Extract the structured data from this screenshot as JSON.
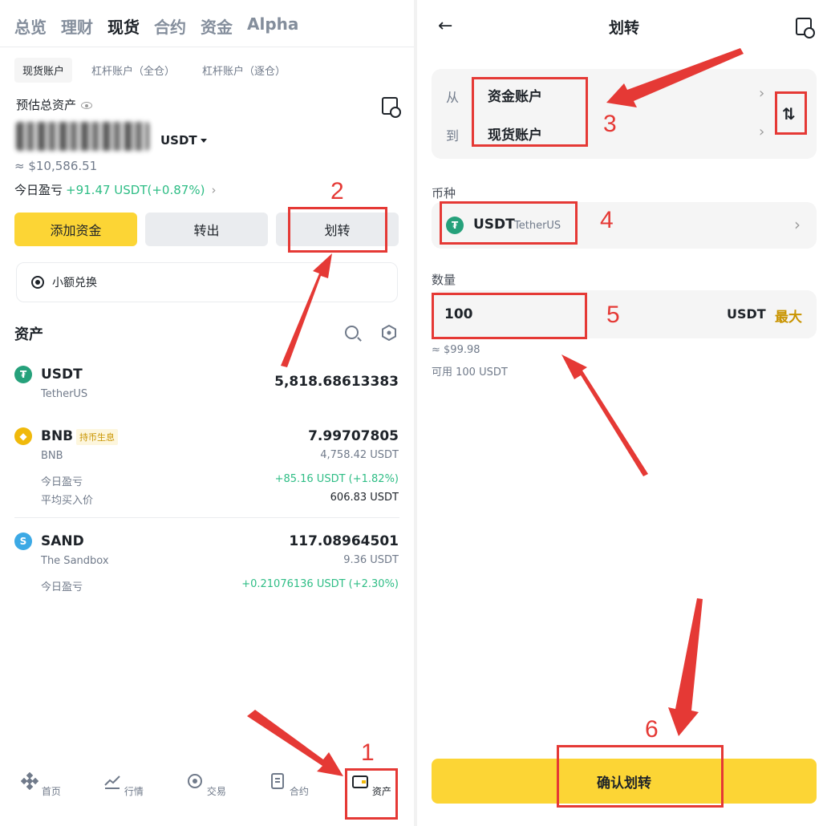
{
  "left": {
    "top_tabs": [
      "总览",
      "理财",
      "现货",
      "合约",
      "资金",
      "Alpha"
    ],
    "sub_tabs": [
      "现货账户",
      "杠杆账户（全仓）",
      "杠杆账户（逐仓）"
    ],
    "estimated_label": "预估总资产",
    "balance_unit": "USDT",
    "approx_usd": "≈ $10,586.51",
    "today_pnl_label": "今日盈亏",
    "today_pnl_value": "+91.47 USDT(+0.87%)",
    "buttons": {
      "add_funds": "添加资金",
      "withdraw": "转出",
      "transfer": "划转"
    },
    "small_convert": "小额兑换",
    "assets_title": "资产",
    "assets": [
      {
        "symbol": "USDT",
        "name": "TetherUS",
        "amount": "5,818.68613383",
        "icon_color": "#26a17b"
      },
      {
        "symbol": "BNB",
        "name": "BNB",
        "badge": "持币生息",
        "amount": "7.99707805",
        "usd": "4,758.42 USDT",
        "pnl_label": "今日盈亏",
        "pnl_value": "+85.16 USDT (+1.82%)",
        "avg_label": "平均买入价",
        "avg_value": "606.83 USDT",
        "icon_color": "#f0b90b"
      },
      {
        "symbol": "SAND",
        "name": "The Sandbox",
        "amount": "117.08964501",
        "usd": "9.36 USDT",
        "pnl_label": "今日盈亏",
        "pnl_value": "+0.21076136 USDT (+2.30%)",
        "icon_color": "#3ca9e5"
      }
    ],
    "nav": [
      "首页",
      "行情",
      "交易",
      "合约",
      "资产"
    ]
  },
  "right": {
    "back": "←",
    "title": "划转",
    "from_label": "从",
    "from_value": "资金账户",
    "to_label": "到",
    "to_value": "现货账户",
    "coin_label": "币种",
    "coin_symbol": "USDT",
    "coin_name": "TetherUS",
    "amount_label": "数量",
    "amount_value": "100",
    "amount_unit": "USDT",
    "max_label": "最大",
    "approx": "≈ $99.98",
    "available": "可用 100 USDT",
    "confirm": "确认划转"
  },
  "annotations": [
    "1",
    "2",
    "3",
    "4",
    "5",
    "6"
  ],
  "colors": {
    "brand_yellow": "#fcd535",
    "positive": "#2ebd85",
    "annotation": "#e53935"
  }
}
